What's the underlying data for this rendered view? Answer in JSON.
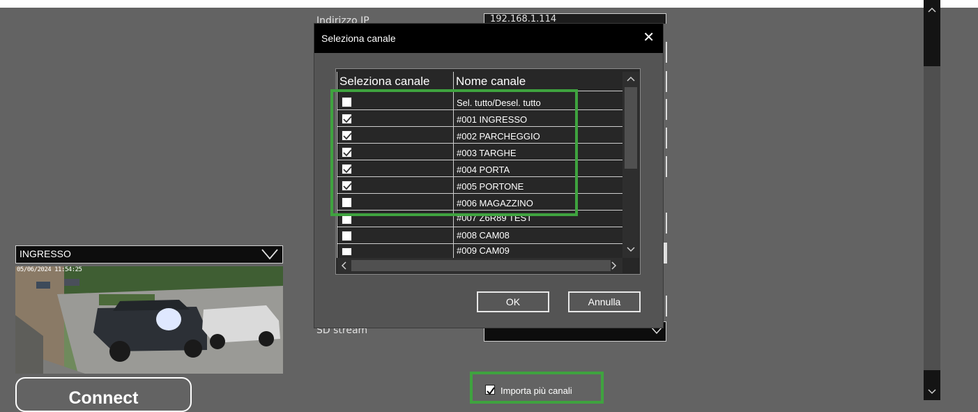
{
  "form": {
    "ip_label": "Indirizzo IP",
    "ip_value": "192.168.1.114",
    "sd_stream_label": "SD stream"
  },
  "preview": {
    "channel_select_value": "INGRESSO",
    "timestamp": "05/06/2024 11:54:25",
    "connect_label": "Connect"
  },
  "import": {
    "checked": true,
    "label": "Importa più canali"
  },
  "dialog": {
    "title": "Seleziona canale",
    "columns": [
      "Seleziona canale",
      "Nome canale"
    ],
    "rows": [
      {
        "checked": false,
        "name": "Sel. tutto/Desel. tutto"
      },
      {
        "checked": true,
        "name": "#001 INGRESSO"
      },
      {
        "checked": true,
        "name": "#002 PARCHEGGIO"
      },
      {
        "checked": true,
        "name": "#003 TARGHE"
      },
      {
        "checked": true,
        "name": "#004 PORTA"
      },
      {
        "checked": true,
        "name": "#005 PORTONE"
      },
      {
        "checked": false,
        "name": "#006 MAGAZZINO"
      },
      {
        "checked": false,
        "name": "#007 Z6R89 TEST"
      },
      {
        "checked": false,
        "name": "#008 CAM08"
      },
      {
        "checked": false,
        "name": "#009 CAM09"
      }
    ],
    "ok_label": "OK",
    "cancel_label": "Annulla"
  },
  "colors": {
    "background": "#636363",
    "dialog": "#545454",
    "highlight": "#3fa33f"
  }
}
